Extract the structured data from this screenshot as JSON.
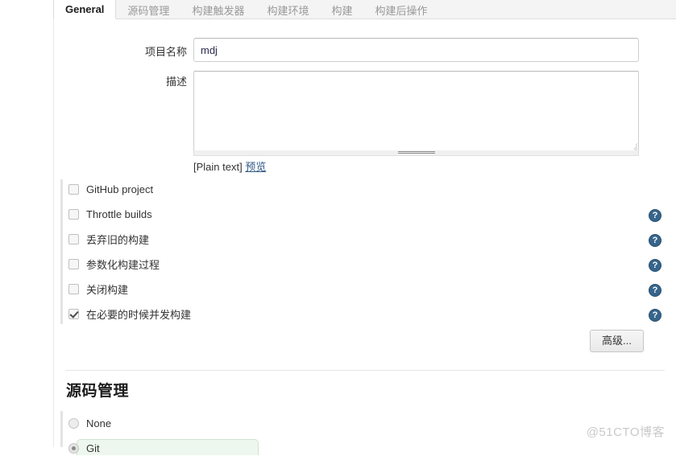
{
  "tabs": [
    {
      "label": "General",
      "active": true
    },
    {
      "label": "源码管理",
      "active": false
    },
    {
      "label": "构建触发器",
      "active": false
    },
    {
      "label": "构建环境",
      "active": false
    },
    {
      "label": "构建",
      "active": false
    },
    {
      "label": "构建后操作",
      "active": false
    }
  ],
  "form": {
    "project_name": {
      "label": "项目名称",
      "value": "mdj",
      "placeholder": ""
    },
    "description": {
      "label": "描述",
      "value": "",
      "placeholder": "",
      "format_note": "[Plain text]",
      "preview_link": "预览"
    }
  },
  "checkboxes": [
    {
      "label": "GitHub project",
      "checked": false,
      "help": "?"
    },
    {
      "label": "Throttle builds",
      "checked": false,
      "help": "?"
    },
    {
      "label": "丢弃旧的构建",
      "checked": false,
      "help": "?"
    },
    {
      "label": "参数化构建过程",
      "checked": false,
      "help": "?"
    },
    {
      "label": "关闭构建",
      "checked": false,
      "help": "?"
    },
    {
      "label": "在必要的时候并发构建",
      "checked": true,
      "help": "?"
    }
  ],
  "advanced_button": {
    "label": "高级..."
  },
  "scm_section": {
    "title": "源码管理",
    "options": [
      {
        "label": "None",
        "selected": false
      },
      {
        "label": "Git",
        "selected": true
      }
    ]
  },
  "watermark": {
    "text": "@51CTO博客"
  },
  "colors": {
    "accent_link": "#345a87",
    "help_icon": "#36648b",
    "tab_active_text": "#1c1c1c",
    "tab_inactive_text": "#999999",
    "panel_bg": "#ffffff",
    "tabbar_bg": "#f4f4f4",
    "git_panel_bg": "#eef7ee"
  }
}
